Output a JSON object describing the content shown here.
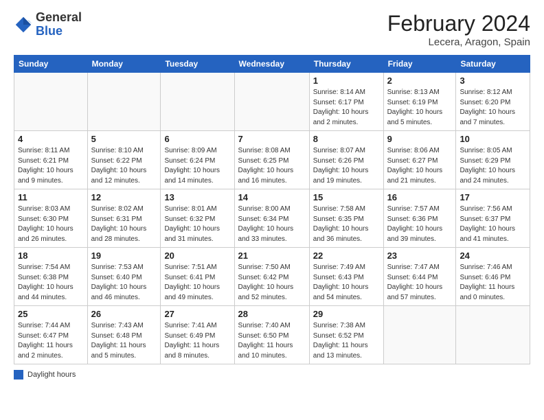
{
  "header": {
    "logo": {
      "general": "General",
      "blue": "Blue"
    },
    "title": "February 2024",
    "location": "Lecera, Aragon, Spain"
  },
  "columns": [
    "Sunday",
    "Monday",
    "Tuesday",
    "Wednesday",
    "Thursday",
    "Friday",
    "Saturday"
  ],
  "weeks": [
    [
      {
        "day": "",
        "info": ""
      },
      {
        "day": "",
        "info": ""
      },
      {
        "day": "",
        "info": ""
      },
      {
        "day": "",
        "info": ""
      },
      {
        "day": "1",
        "info": "Sunrise: 8:14 AM\nSunset: 6:17 PM\nDaylight: 10 hours\nand 2 minutes."
      },
      {
        "day": "2",
        "info": "Sunrise: 8:13 AM\nSunset: 6:19 PM\nDaylight: 10 hours\nand 5 minutes."
      },
      {
        "day": "3",
        "info": "Sunrise: 8:12 AM\nSunset: 6:20 PM\nDaylight: 10 hours\nand 7 minutes."
      }
    ],
    [
      {
        "day": "4",
        "info": "Sunrise: 8:11 AM\nSunset: 6:21 PM\nDaylight: 10 hours\nand 9 minutes."
      },
      {
        "day": "5",
        "info": "Sunrise: 8:10 AM\nSunset: 6:22 PM\nDaylight: 10 hours\nand 12 minutes."
      },
      {
        "day": "6",
        "info": "Sunrise: 8:09 AM\nSunset: 6:24 PM\nDaylight: 10 hours\nand 14 minutes."
      },
      {
        "day": "7",
        "info": "Sunrise: 8:08 AM\nSunset: 6:25 PM\nDaylight: 10 hours\nand 16 minutes."
      },
      {
        "day": "8",
        "info": "Sunrise: 8:07 AM\nSunset: 6:26 PM\nDaylight: 10 hours\nand 19 minutes."
      },
      {
        "day": "9",
        "info": "Sunrise: 8:06 AM\nSunset: 6:27 PM\nDaylight: 10 hours\nand 21 minutes."
      },
      {
        "day": "10",
        "info": "Sunrise: 8:05 AM\nSunset: 6:29 PM\nDaylight: 10 hours\nand 24 minutes."
      }
    ],
    [
      {
        "day": "11",
        "info": "Sunrise: 8:03 AM\nSunset: 6:30 PM\nDaylight: 10 hours\nand 26 minutes."
      },
      {
        "day": "12",
        "info": "Sunrise: 8:02 AM\nSunset: 6:31 PM\nDaylight: 10 hours\nand 28 minutes."
      },
      {
        "day": "13",
        "info": "Sunrise: 8:01 AM\nSunset: 6:32 PM\nDaylight: 10 hours\nand 31 minutes."
      },
      {
        "day": "14",
        "info": "Sunrise: 8:00 AM\nSunset: 6:34 PM\nDaylight: 10 hours\nand 33 minutes."
      },
      {
        "day": "15",
        "info": "Sunrise: 7:58 AM\nSunset: 6:35 PM\nDaylight: 10 hours\nand 36 minutes."
      },
      {
        "day": "16",
        "info": "Sunrise: 7:57 AM\nSunset: 6:36 PM\nDaylight: 10 hours\nand 39 minutes."
      },
      {
        "day": "17",
        "info": "Sunrise: 7:56 AM\nSunset: 6:37 PM\nDaylight: 10 hours\nand 41 minutes."
      }
    ],
    [
      {
        "day": "18",
        "info": "Sunrise: 7:54 AM\nSunset: 6:38 PM\nDaylight: 10 hours\nand 44 minutes."
      },
      {
        "day": "19",
        "info": "Sunrise: 7:53 AM\nSunset: 6:40 PM\nDaylight: 10 hours\nand 46 minutes."
      },
      {
        "day": "20",
        "info": "Sunrise: 7:51 AM\nSunset: 6:41 PM\nDaylight: 10 hours\nand 49 minutes."
      },
      {
        "day": "21",
        "info": "Sunrise: 7:50 AM\nSunset: 6:42 PM\nDaylight: 10 hours\nand 52 minutes."
      },
      {
        "day": "22",
        "info": "Sunrise: 7:49 AM\nSunset: 6:43 PM\nDaylight: 10 hours\nand 54 minutes."
      },
      {
        "day": "23",
        "info": "Sunrise: 7:47 AM\nSunset: 6:44 PM\nDaylight: 10 hours\nand 57 minutes."
      },
      {
        "day": "24",
        "info": "Sunrise: 7:46 AM\nSunset: 6:46 PM\nDaylight: 11 hours\nand 0 minutes."
      }
    ],
    [
      {
        "day": "25",
        "info": "Sunrise: 7:44 AM\nSunset: 6:47 PM\nDaylight: 11 hours\nand 2 minutes."
      },
      {
        "day": "26",
        "info": "Sunrise: 7:43 AM\nSunset: 6:48 PM\nDaylight: 11 hours\nand 5 minutes."
      },
      {
        "day": "27",
        "info": "Sunrise: 7:41 AM\nSunset: 6:49 PM\nDaylight: 11 hours\nand 8 minutes."
      },
      {
        "day": "28",
        "info": "Sunrise: 7:40 AM\nSunset: 6:50 PM\nDaylight: 11 hours\nand 10 minutes."
      },
      {
        "day": "29",
        "info": "Sunrise: 7:38 AM\nSunset: 6:52 PM\nDaylight: 11 hours\nand 13 minutes."
      },
      {
        "day": "",
        "info": ""
      },
      {
        "day": "",
        "info": ""
      }
    ]
  ],
  "legend": {
    "box_color": "#2563c0",
    "label": "Daylight hours"
  }
}
